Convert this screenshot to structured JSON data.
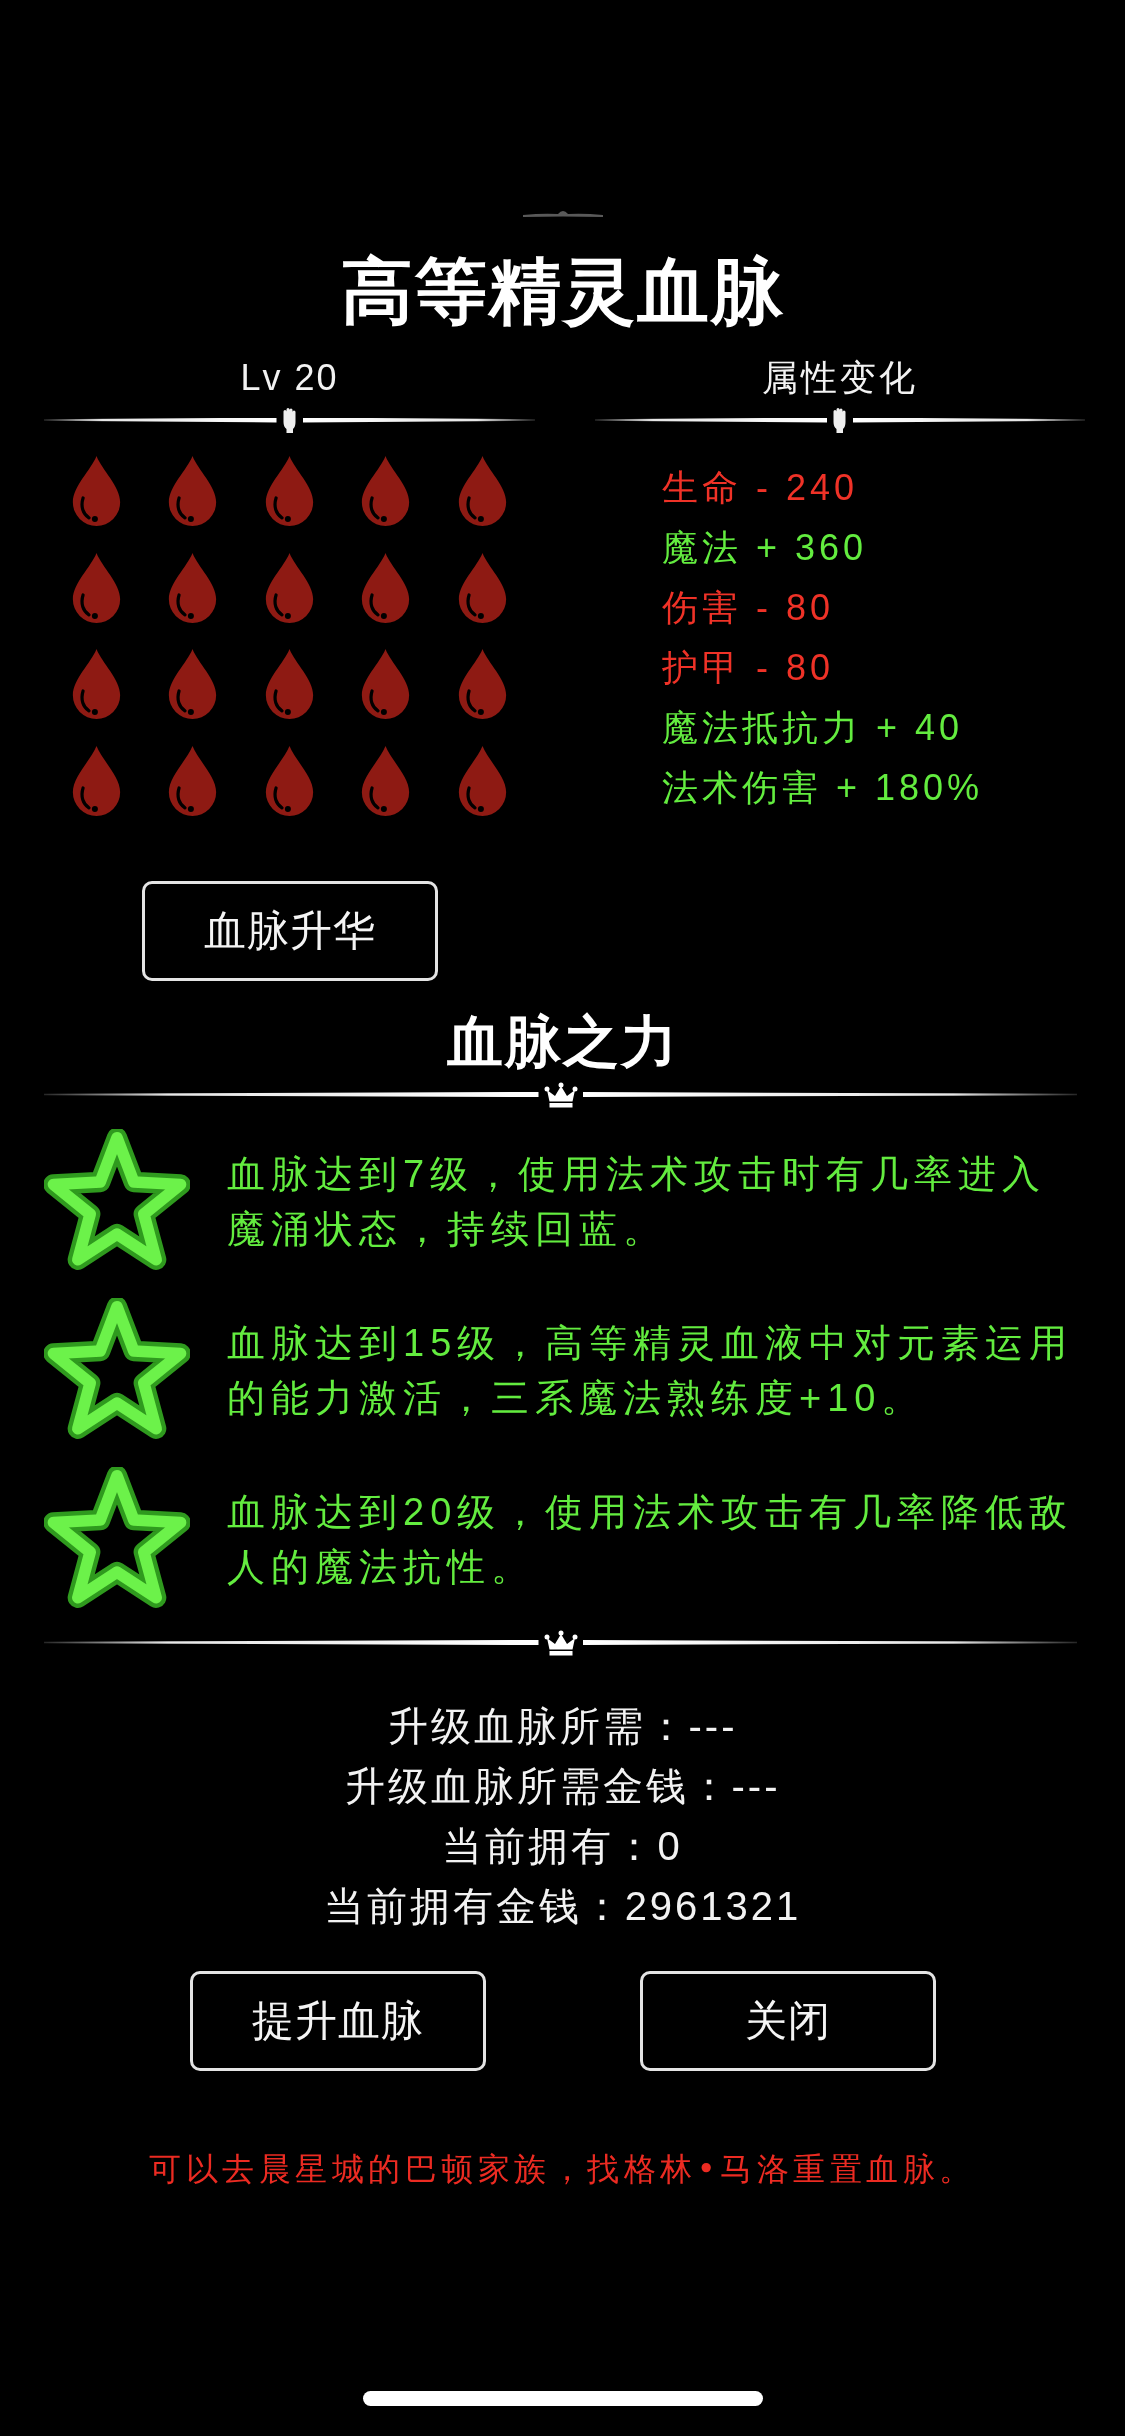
{
  "title": "高等精灵血脉",
  "level_panel": {
    "label": "Lv 20",
    "drop_rows": [
      {
        "stars": 5
      },
      {
        "stars": 5
      },
      {
        "stars": 5
      },
      {
        "stars": 5
      }
    ],
    "button": "血脉升华"
  },
  "attributes_panel": {
    "heading": "属性变化",
    "attributes": [
      {
        "text": "生命 - 240",
        "color": "#ef3227"
      },
      {
        "text": "魔法 + 360",
        "color": "#63ec3f"
      },
      {
        "text": "伤害 - 80",
        "color": "#ef3227"
      },
      {
        "text": "护甲 - 80",
        "color": "#ef3227"
      },
      {
        "text": "魔法抵抗力 + 40",
        "color": "#63ec3f"
      },
      {
        "text": "法术伤害 + 180%",
        "color": "#63ec3f"
      }
    ]
  },
  "powers": {
    "heading": "血脉之力",
    "items": [
      "血脉达到7级，使用法术攻击时有几率进入魔涌状态，持续回蓝。",
      "血脉达到15级，高等精灵血液中对元素运用的能力激活，三系魔法熟练度+10。",
      "血脉达到20级，使用法术攻击有几率降低敌人的魔法抗性。"
    ]
  },
  "requirements": [
    "升级血脉所需：---",
    "升级血脉所需金钱：---",
    "当前拥有：0",
    "当前拥有金钱：2961321"
  ],
  "buttons": [
    "提升血脉",
    "关闭"
  ],
  "note": "可以去晨星城的巴顿家族，找格林•马洛重置血脉。"
}
